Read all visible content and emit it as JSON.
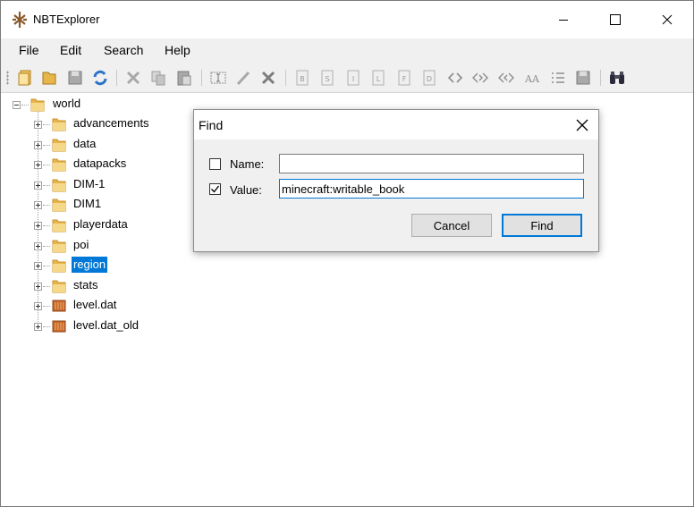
{
  "window": {
    "title": "NBTExplorer"
  },
  "menu": [
    "File",
    "Edit",
    "Search",
    "Help"
  ],
  "toolbar": {
    "icons": [
      "open-folder-icon",
      "open-file-icon",
      "save-icon",
      "refresh-icon",
      "cut-icon",
      "copy-icon",
      "paste-icon",
      "rename-icon",
      "edit-icon",
      "delete-icon",
      "tag-byte-icon",
      "tag-short-icon",
      "tag-int-icon",
      "tag-long-icon",
      "tag-float-icon",
      "tag-double-icon",
      "tag-byte-array-icon",
      "tag-int-array-icon",
      "tag-long-array-icon",
      "tag-string-icon",
      "tag-list-icon",
      "tag-compound-icon",
      "find-icon"
    ]
  },
  "tree": {
    "root": "world",
    "children": [
      {
        "label": "advancements",
        "kind": "folder"
      },
      {
        "label": "data",
        "kind": "folder"
      },
      {
        "label": "datapacks",
        "kind": "folder"
      },
      {
        "label": "DIM-1",
        "kind": "folder"
      },
      {
        "label": "DIM1",
        "kind": "folder"
      },
      {
        "label": "playerdata",
        "kind": "folder"
      },
      {
        "label": "poi",
        "kind": "folder"
      },
      {
        "label": "region",
        "kind": "folder",
        "selected": true
      },
      {
        "label": "stats",
        "kind": "folder"
      },
      {
        "label": "level.dat",
        "kind": "file"
      },
      {
        "label": "level.dat_old",
        "kind": "file"
      }
    ]
  },
  "find_dialog": {
    "title": "Find",
    "name_label": "Name:",
    "name_checked": false,
    "name_value": "",
    "value_label": "Value:",
    "value_checked": true,
    "value_value": "minecraft:writable_book",
    "cancel_label": "Cancel",
    "find_label": "Find"
  },
  "colors": {
    "selection": "#0078d7",
    "folder": "#e8b54a",
    "file": "#c96a2a"
  }
}
